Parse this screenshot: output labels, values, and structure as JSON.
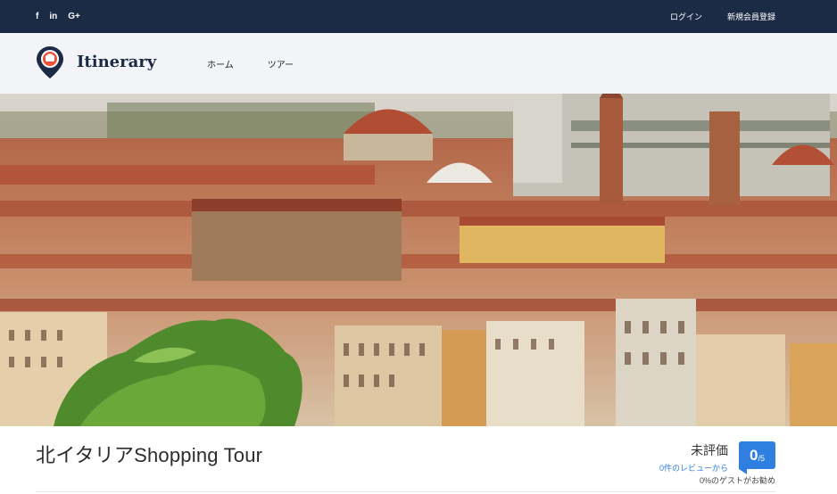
{
  "topbar": {
    "social": [
      {
        "icon": "facebook-icon",
        "label": "f"
      },
      {
        "icon": "linkedin-icon",
        "label": "in"
      },
      {
        "icon": "google-plus-icon",
        "label": "G+"
      }
    ],
    "login_label": "ログイン",
    "register_label": "新規会員登録"
  },
  "header": {
    "logo_text": "Itinerary",
    "nav": [
      {
        "label": "ホーム"
      },
      {
        "label": "ツアー"
      }
    ]
  },
  "hero": {
    "image": "florence-cityscape-photo"
  },
  "tour": {
    "title": "北イタリアShopping Tour",
    "rating_status": "未評価",
    "reviews_link": "0件のレビューから",
    "score": "0",
    "score_max": "/5",
    "recommend_text": "0%のゲストがお勧め"
  },
  "colors": {
    "topbar_bg": "#1c2b45",
    "header_bg": "#f3f4f7",
    "accent": "#2f7fe0",
    "logo_pin": "#f04e37"
  }
}
